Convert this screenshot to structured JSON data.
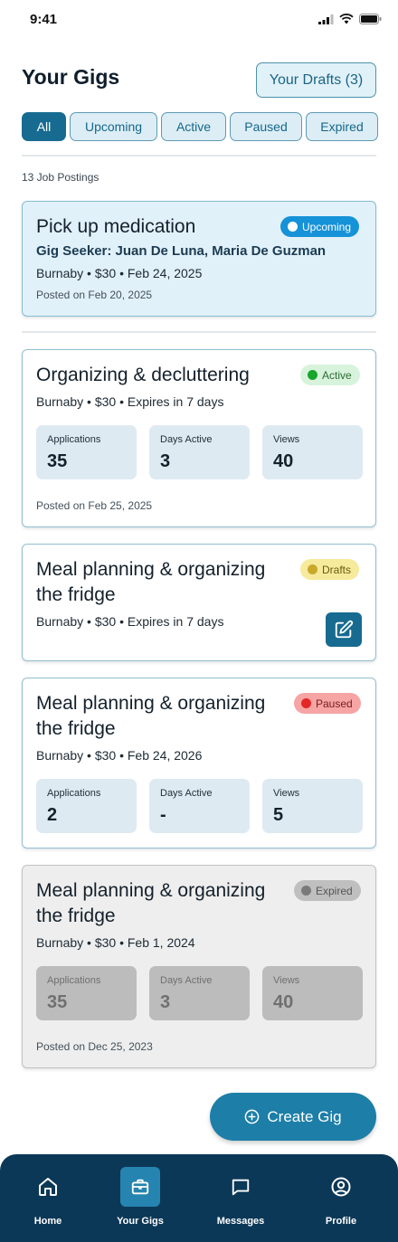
{
  "status_bar": {
    "time": "9:41"
  },
  "header": {
    "title": "Your Gigs",
    "drafts_button": "Your Drafts (3)"
  },
  "filters": [
    "All",
    "Upcoming",
    "Active",
    "Paused",
    "Expired"
  ],
  "active_filter": "All",
  "postings_count": "13 Job Postings",
  "cards": [
    {
      "title": "Pick up medication",
      "badge": "Upcoming",
      "seeker": "Gig Seeker: Juan De Luna, Maria De Guzman",
      "meta": "Burnaby • $30 • Feb 24, 2025",
      "posted": "Posted on Feb 20, 2025"
    },
    {
      "title": "Organizing & decluttering",
      "badge": "Active",
      "meta": "Burnaby • $30 • Expires in 7 days",
      "stats": [
        {
          "label": "Applications",
          "value": "35"
        },
        {
          "label": "Days Active",
          "value": "3"
        },
        {
          "label": "Views",
          "value": "40"
        }
      ],
      "posted": "Posted on Feb 25, 2025"
    },
    {
      "title_line1": "Meal planning & organizing",
      "title_line2": "the fridge",
      "badge": "Drafts",
      "meta": "Burnaby • $30 • Expires in 7 days"
    },
    {
      "title_line1": "Meal planning & organizing",
      "title_line2": "the fridge",
      "badge": "Paused",
      "meta": "Burnaby • $30 • Feb 24, 2026",
      "stats": [
        {
          "label": "Applications",
          "value": "2"
        },
        {
          "label": "Days Active",
          "value": "-"
        },
        {
          "label": "Views",
          "value": "5"
        }
      ]
    },
    {
      "title_line1": "Meal planning & organizing",
      "title_line2": "the fridge",
      "badge": "Expired",
      "meta": "Burnaby • $30 • Feb 1, 2024",
      "stats": [
        {
          "label": "Applications",
          "value": "35"
        },
        {
          "label": "Days Active",
          "value": "3"
        },
        {
          "label": "Views",
          "value": "40"
        }
      ],
      "posted": "Posted on Dec 25, 2023"
    }
  ],
  "create_button": "Create Gig",
  "nav": [
    {
      "label": "Home",
      "icon": "home-icon"
    },
    {
      "label": "Your Gigs",
      "icon": "briefcase-icon"
    },
    {
      "label": "Messages",
      "icon": "message-icon"
    },
    {
      "label": "Profile",
      "icon": "profile-icon"
    }
  ],
  "selected_nav": "Your Gigs",
  "colors": {
    "primary": "#176b91",
    "nav_background": "#0c3857",
    "upcoming": "#1592d8",
    "active": "#17a52c",
    "drafts": "#c9a82a",
    "paused": "#e32626",
    "expired": "#7a7a7a"
  }
}
